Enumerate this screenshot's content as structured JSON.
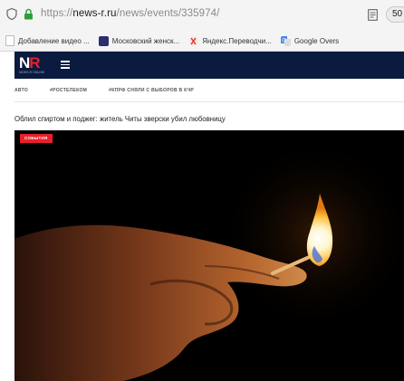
{
  "browser": {
    "url_scheme": "https://",
    "url_host": "news-r.ru",
    "url_path": "/news/events/335974/",
    "zoom": "50"
  },
  "bookmarks": [
    {
      "label": "Добавление видео ...",
      "icon": "page-icon",
      "color": "#9e9e9e"
    },
    {
      "label": "Московский женск...",
      "icon": "site-icon",
      "color": "#3b3f8a"
    },
    {
      "label": "Яндекс.Переводчи...",
      "icon": "translate-icon",
      "color": "#d33a2c"
    },
    {
      "label": "Google Overs",
      "icon": "google-translate-icon",
      "color": "#4a86e8"
    }
  ],
  "site": {
    "logo_text_left": "N",
    "logo_text_right": "R",
    "logo_sub": "NEWS-R ONLINE",
    "tags": [
      "АВТО",
      "#РОСТЕЛЕКОМ",
      "#КПРФ СНЯЛИ С ВЫБОРОВ В КЧР"
    ],
    "headline": "Облил спиртом и поджег: житель Читы зверски убил любовницу",
    "badge": "СОБЫТИЯ",
    "colors": {
      "navbar": "#0b1a3f",
      "accent": "#e8202a"
    }
  }
}
